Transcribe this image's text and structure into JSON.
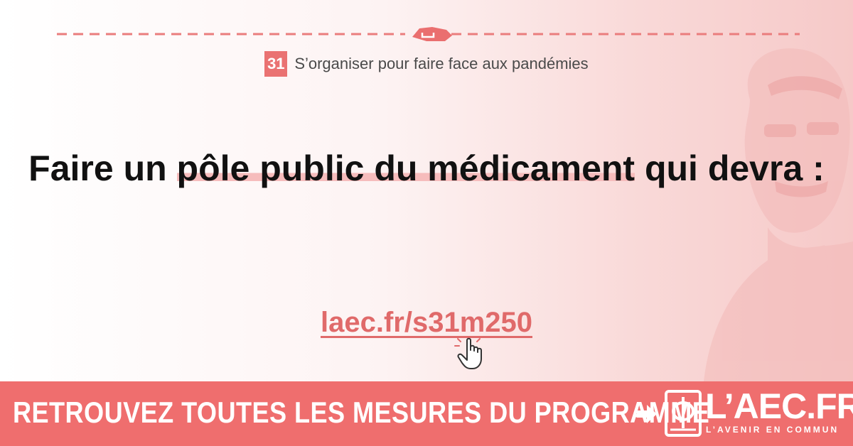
{
  "chapter": {
    "number": "31",
    "title": "S’organiser pour faire face aux pandémies"
  },
  "headline": {
    "part1": "Faire un ",
    "highlight": "pôle public du médicament",
    "part2": " qui devra :"
  },
  "link": {
    "text": "laec.fr/s31m250"
  },
  "footer": {
    "cta": "RETROUVEZ TOUTES LES MESURES DU PROGRAMME",
    "brand": "L’AEC.FR",
    "tagline": "L’AVENIR EN COMMUN"
  },
  "colors": {
    "accent": "#ef6e6e",
    "text": "#111111",
    "muted": "#4a4a4a",
    "link": "#e06a6a"
  },
  "icons": [
    "handshake-icon",
    "pointer-hand-icon",
    "arrow-right-icon",
    "phi-logo-icon"
  ]
}
